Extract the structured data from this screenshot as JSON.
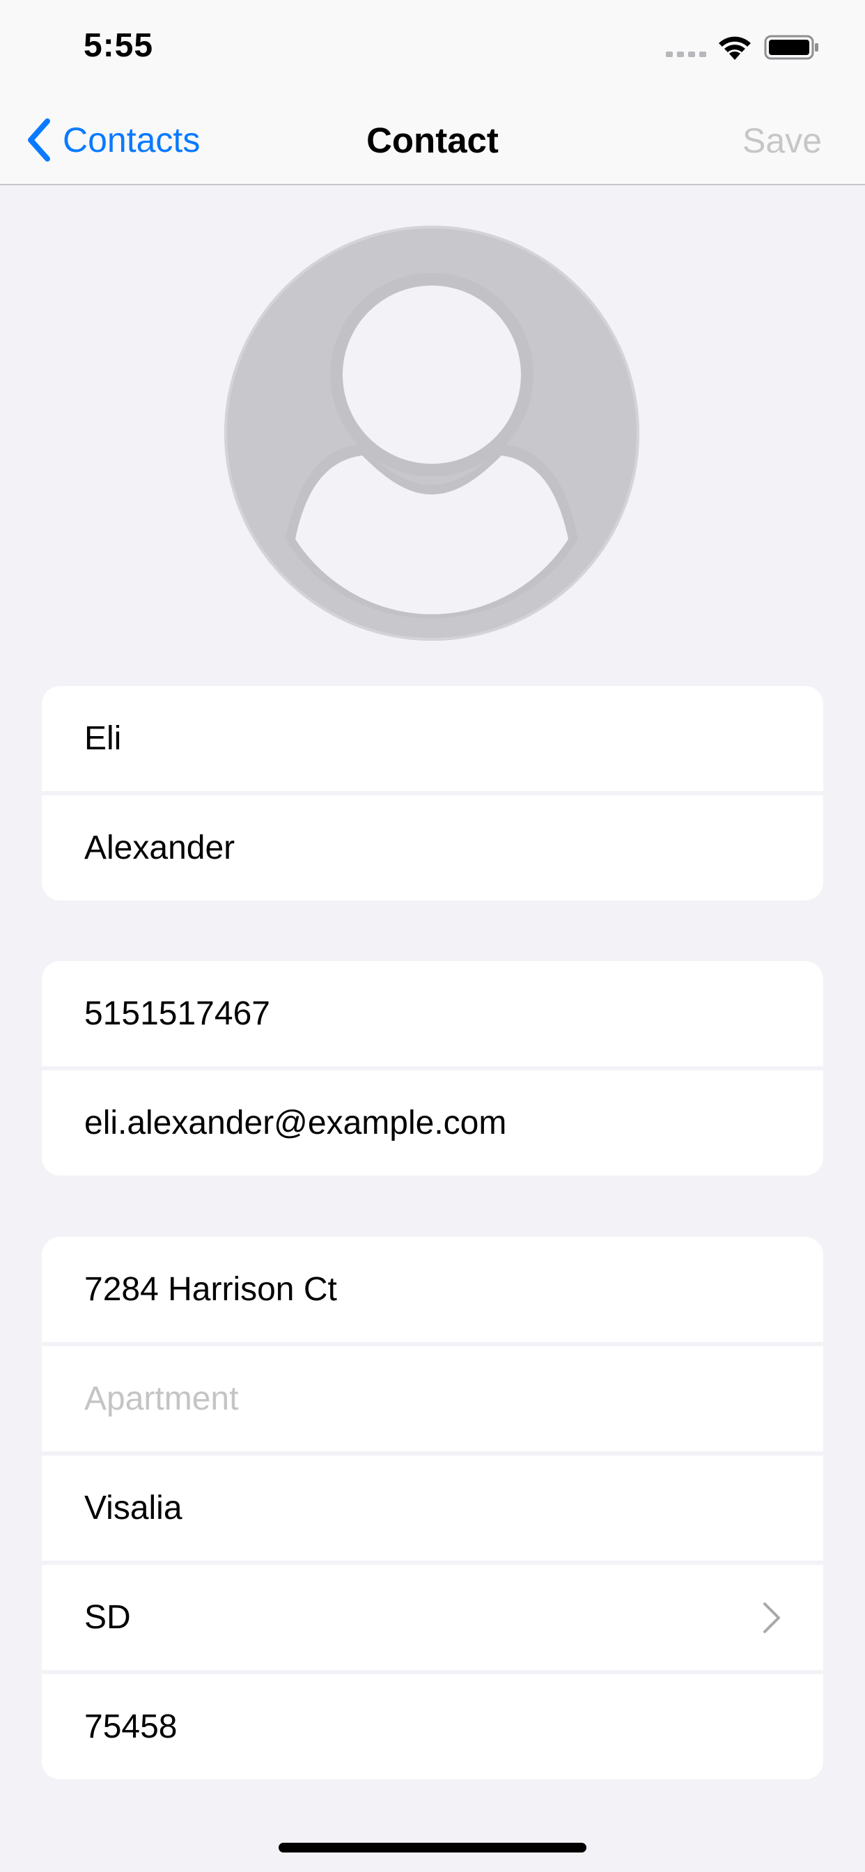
{
  "status_bar": {
    "time": "5:55"
  },
  "nav": {
    "back_label": "Contacts",
    "title": "Contact",
    "save_label": "Save"
  },
  "name_group": {
    "first_name": "Eli",
    "last_name": "Alexander"
  },
  "contact_group": {
    "phone": "5151517467",
    "email": "eli.alexander@example.com"
  },
  "address_group": {
    "street": "7284 Harrison Ct",
    "apartment_placeholder": "Apartment",
    "city": "Visalia",
    "state": "SD",
    "zip": "75458"
  },
  "colors": {
    "accent": "#0a7aff",
    "background": "#f2f2f7",
    "disabled": "#c6c6c8",
    "avatar": "#c7c7cc"
  },
  "icons": {
    "back": "chevron-left-icon",
    "avatar": "person-silhouette-icon",
    "state_picker": "chevron-right-icon"
  }
}
